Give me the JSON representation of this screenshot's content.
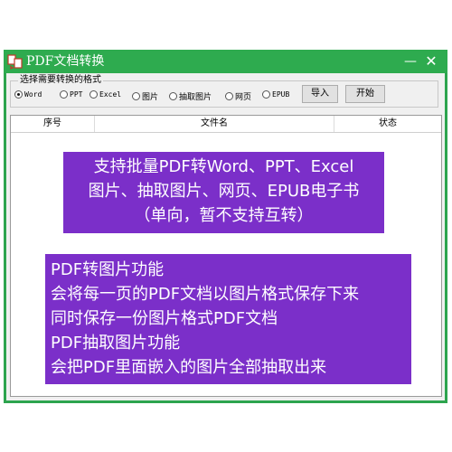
{
  "window": {
    "title": "PDF文档转换",
    "minimize_glyph": "—",
    "close_glyph": "✕"
  },
  "format_group": {
    "legend": "选择需要转换的格式",
    "options": [
      {
        "label": "Word",
        "selected": true
      },
      {
        "label": "PPT",
        "selected": false
      },
      {
        "label": "Excel",
        "selected": false
      },
      {
        "label": "图片",
        "selected": false
      },
      {
        "label": "抽取图片",
        "selected": false
      },
      {
        "label": "网页",
        "selected": false
      },
      {
        "label": "EPUB",
        "selected": false
      }
    ]
  },
  "buttons": {
    "import": "导入",
    "start": "开始"
  },
  "table": {
    "columns": [
      "序号",
      "文件名",
      "状态"
    ]
  },
  "overlay": {
    "banner1": [
      "支持批量PDF转Word、PPT、Excel",
      "图片、抽取图片、网页、EPUB电子书",
      "（单向，暂不支持互转）"
    ],
    "banner2": [
      "PDF转图片功能",
      "会将每一页的PDF文档以图片格式保存下来",
      "同时保存一份图片格式PDF文档",
      "PDF抽取图片功能",
      "会把PDF里面嵌入的图片全部抽取出来"
    ]
  },
  "colors": {
    "titlebar": "#2eab4f",
    "banner": "#7b2fc9"
  }
}
